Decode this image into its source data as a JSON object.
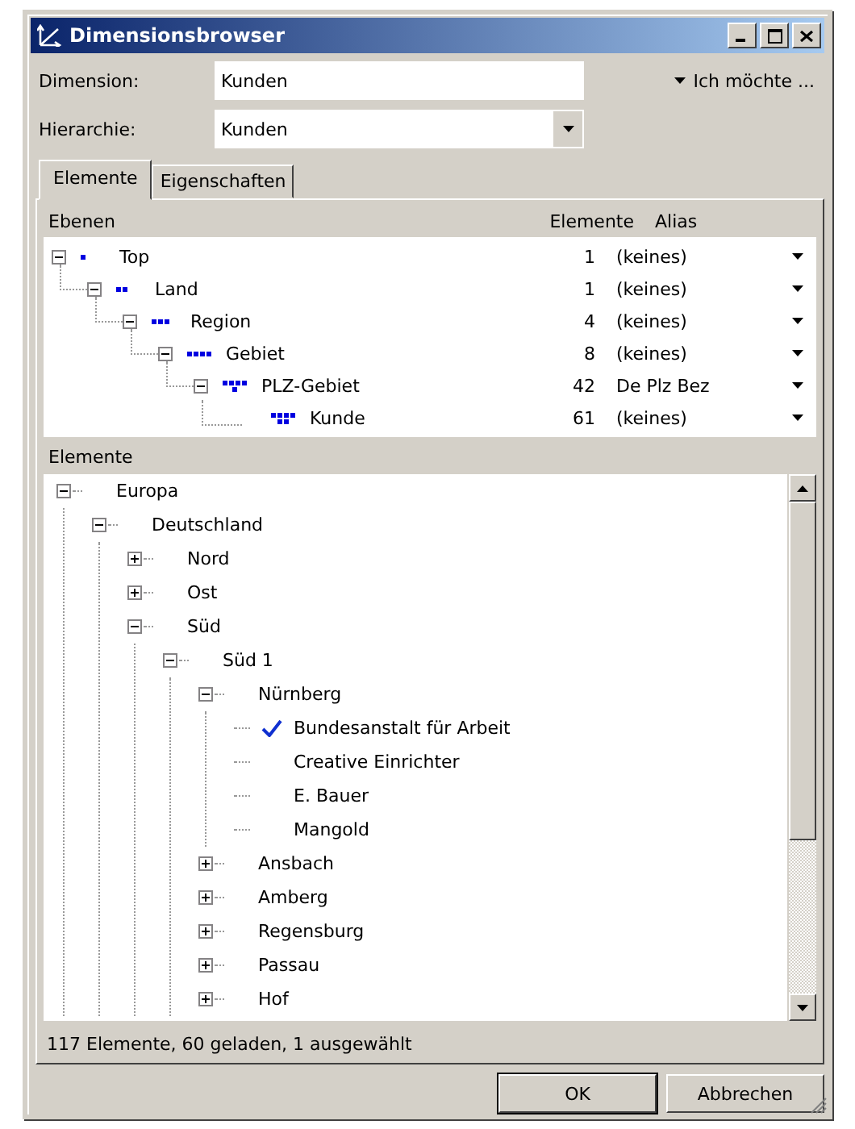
{
  "window": {
    "title": "Dimensionsbrowser"
  },
  "fields": [
    {
      "label": "Dimension:",
      "value": "Kunden",
      "kind": "text"
    },
    {
      "label": "Hierarchie:",
      "value": "Kunden",
      "kind": "combo"
    }
  ],
  "action_menu": "Ich möchte ...",
  "tabs": [
    {
      "label": "Elemente",
      "selected": true
    },
    {
      "label": "Eigenschaften",
      "selected": false
    }
  ],
  "levels": {
    "columns": [
      "Ebenen",
      "Elemente",
      "Alias"
    ],
    "rows": [
      {
        "name": "Top",
        "count": "1",
        "alias": "(keines)",
        "kind": "branch",
        "expanded": true,
        "children": [
          {
            "name": "Land",
            "count": "1",
            "alias": "(keines)",
            "kind": "branch",
            "expanded": true,
            "children": [
              {
                "name": "Region",
                "count": "4",
                "alias": "(keines)",
                "kind": "branch",
                "expanded": true,
                "children": [
                  {
                    "name": "Gebiet",
                    "count": "8",
                    "alias": "(keines)",
                    "kind": "branch",
                    "expanded": true,
                    "children": [
                      {
                        "name": "PLZ-Gebiet",
                        "count": "42",
                        "alias": "De Plz Bez",
                        "kind": "branch",
                        "expanded": true,
                        "children": [
                          {
                            "name": "Kunde",
                            "count": "61",
                            "alias": "(keines)",
                            "kind": "leaf"
                          }
                        ]
                      }
                    ]
                  }
                ]
              }
            ]
          }
        ]
      }
    ]
  },
  "elements": {
    "label": "Elemente",
    "tree": [
      {
        "label": "Europa",
        "kind": "branch",
        "expanded": true,
        "checked": false,
        "children": [
          {
            "label": "Deutschland",
            "kind": "branch",
            "expanded": true,
            "checked": false,
            "children": [
              {
                "label": "Nord",
                "kind": "branch",
                "expanded": false,
                "checked": false
              },
              {
                "label": "Ost",
                "kind": "branch",
                "expanded": false,
                "checked": false
              },
              {
                "label": "Süd",
                "kind": "branch",
                "expanded": true,
                "checked": false,
                "children": [
                  {
                    "label": "Süd 1",
                    "kind": "branch",
                    "expanded": true,
                    "checked": false,
                    "children": [
                      {
                        "label": "Nürnberg",
                        "kind": "branch",
                        "expanded": true,
                        "checked": false,
                        "children": [
                          {
                            "label": "Bundesanstalt für Arbeit",
                            "kind": "leaf",
                            "checked": true
                          },
                          {
                            "label": "Creative Einrichter",
                            "kind": "leaf",
                            "checked": false
                          },
                          {
                            "label": "E. Bauer",
                            "kind": "leaf",
                            "checked": false
                          },
                          {
                            "label": "Mangold",
                            "kind": "leaf",
                            "checked": false
                          }
                        ]
                      },
                      {
                        "label": "Ansbach",
                        "kind": "branch",
                        "expanded": false,
                        "checked": false
                      },
                      {
                        "label": "Amberg",
                        "kind": "branch",
                        "expanded": false,
                        "checked": false
                      },
                      {
                        "label": "Regensburg",
                        "kind": "branch",
                        "expanded": false,
                        "checked": false
                      },
                      {
                        "label": "Passau",
                        "kind": "branch",
                        "expanded": false,
                        "checked": false
                      },
                      {
                        "label": "Hof",
                        "kind": "branch",
                        "expanded": false,
                        "checked": false
                      }
                    ]
                  }
                ]
              }
            ]
          }
        ]
      }
    ]
  },
  "status": "117 Elemente, 60 geladen, 1 ausgewählt",
  "buttons": [
    {
      "label": "OK",
      "default": true
    },
    {
      "label": "Abbrechen",
      "default": false
    }
  ]
}
